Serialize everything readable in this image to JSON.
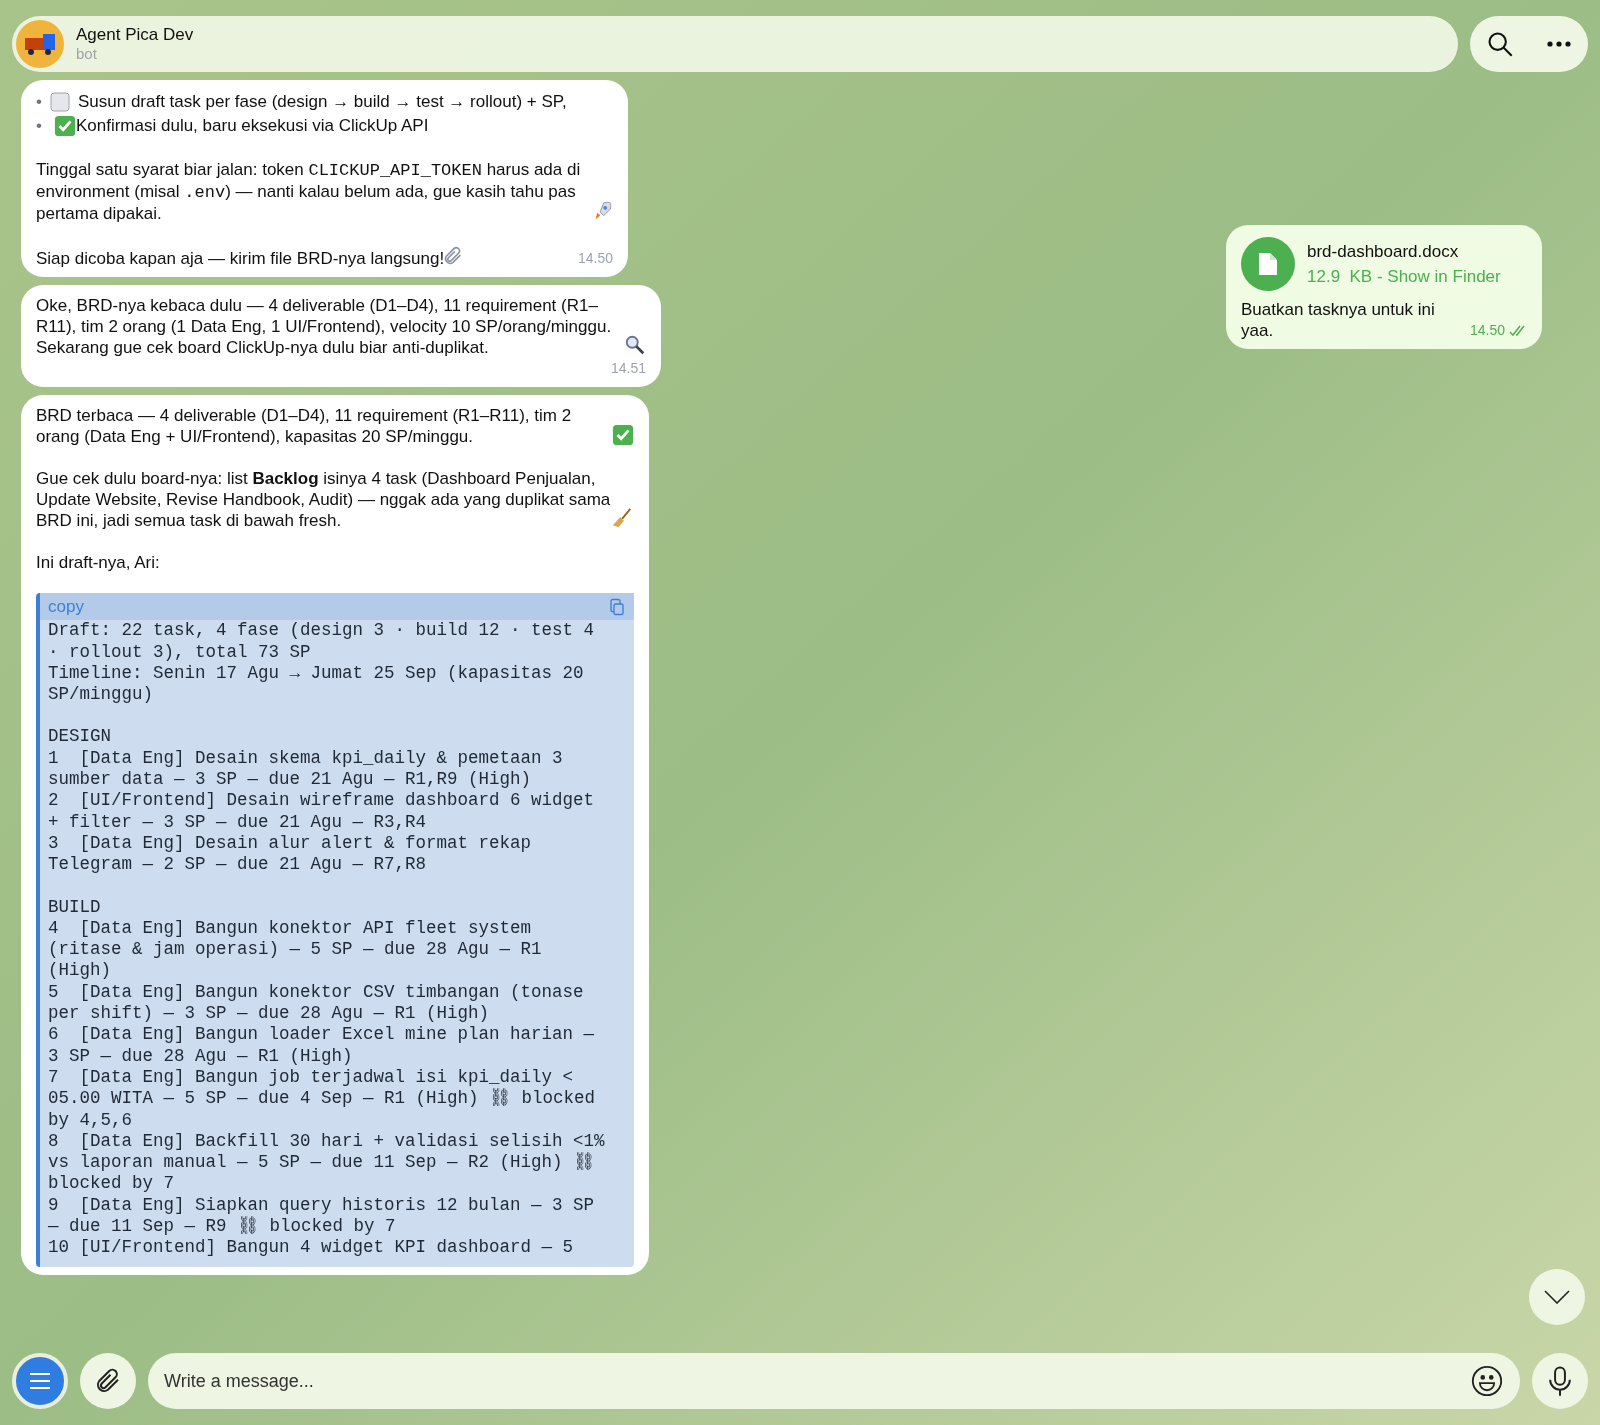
{
  "header": {
    "name": "Agent Pica Dev",
    "subtitle": "bot"
  },
  "messages_left": [
    {
      "kind": "text",
      "time": "14.50",
      "bullets": [
        {
          "bullet": "•",
          "text": "Susun draft task per fase (design → build → test → rollout) + SP,"
        },
        {
          "bullet": "•",
          "text": "Konfirmasi dulu, baru eksekusi via ClickUp API"
        }
      ],
      "paragraphs": [
        {
          "segments": [
            {
              "kind": "text",
              "text": "Tinggal satu syarat biar jalan: token "
            },
            {
              "kind": "code",
              "text": "CLICKUP_API_TOKEN"
            },
            {
              "kind": "text",
              "text": " harus ada di environment (misal "
            },
            {
              "kind": "code",
              "text": ".env"
            },
            {
              "kind": "text",
              "text": ") — nanti kalau belum ada, gue kasih tahu pas pertama dipakai."
            }
          ]
        },
        {
          "segments": [
            {
              "kind": "text",
              "text": "Siap dicoba kapan aja — kirim file BRD-nya langsung!"
            }
          ]
        }
      ]
    },
    {
      "kind": "text",
      "time": "14.51",
      "paragraphs": [
        {
          "segments": [
            {
              "kind": "text",
              "text": "Oke, BRD-nya kebaca dulu — 4 deliverable (D1–D4), 11 requirement (R1–R11), tim 2 orang (1 Data Eng, 1 UI/Frontend), velocity 10 SP/orang/minggu. Sekarang gue cek board ClickUp-nya dulu biar anti-duplikat."
            }
          ]
        }
      ]
    },
    {
      "kind": "draft",
      "paragraphs": [
        {
          "segments": [
            {
              "kind": "rich",
              "text": "BRD terbaca — 4 deliverable (D1–D4), 11 requirement (R1–R11), tim 2 orang (Data Eng + UI/Frontend), kapasitas 20 SP/minggu."
            }
          ]
        },
        {
          "segments": [
            {
              "kind": "rich",
              "text": "Gue cek dulu board-nya: list **Backlog** isinya 4 task (Dashboard Penjualan, Update Website, Revise Handbook, Audit) — nggak ada yang duplikat sama BRD ini, jadi semua task di bawah fresh."
            }
          ]
        },
        {
          "segments": [
            {
              "kind": "text",
              "text": "Ini draft-nya, Ari:"
            }
          ]
        }
      ],
      "code": {
        "label": "copy",
        "intro": [
          "Draft: 22 task, 4 fase (design 3 · build 12 · test 4 · rollout 3), total 73 SP",
          "Timeline: Senin 17 Agu → Jumat 25 Sep (kapasitas 20 SP/minggu)"
        ],
        "sections": [
          {
            "heading": "DESIGN",
            "tasks": [
              "1  [Data Eng] Desain skema kpi_daily & pemetaan 3 sumber data — 3 SP — due 21 Agu — R1,R9 (High)",
              "2  [UI/Frontend] Desain wireframe dashboard 6 widget + filter — 3 SP — due 21 Agu — R3,R4",
              "3  [Data Eng] Desain alur alert & format rekap Telegram — 2 SP — due 21 Agu — R7,R8"
            ]
          },
          {
            "heading": "BUILD",
            "tasks": [
              "4  [Data Eng] Bangun konektor API fleet system (ritase & jam operasi) — 5 SP — due 28 Agu — R1 (High)",
              "5  [Data Eng] Bangun konektor CSV timbangan (tonase per shift) — 3 SP — due 28 Agu — R1 (High)",
              "6  [Data Eng] Bangun loader Excel mine plan harian — 3 SP — due 28 Agu — R1 (High)",
              "7  [Data Eng] Bangun job terjadwal isi kpi_daily < 05.00 WITA — 5 SP — due 4 Sep — R1 (High) ⛓ blocked by 4,5,6",
              "8  [Data Eng] Backfill 30 hari + validasi selisih <1% vs laporan manual — 5 SP — due 11 Sep — R2 (High) ⛓ blocked by 7",
              "9  [Data Eng] Siapkan query historis 12 bulan — 3 SP — due 11 Sep — R9 ⛓ blocked by 7",
              "10 [UI/Frontend] Bangun 4 widget KPI dashboard — 5"
            ]
          }
        ]
      }
    }
  ],
  "file_message": {
    "file_name": "brd-dashboard.docx",
    "file_info": "12.9  KB - Show in Finder",
    "caption": "Buatkan tasknya untuk ini yaa.",
    "time": "14.50",
    "read": true
  },
  "composer": {
    "placeholder": "Write a message..."
  }
}
